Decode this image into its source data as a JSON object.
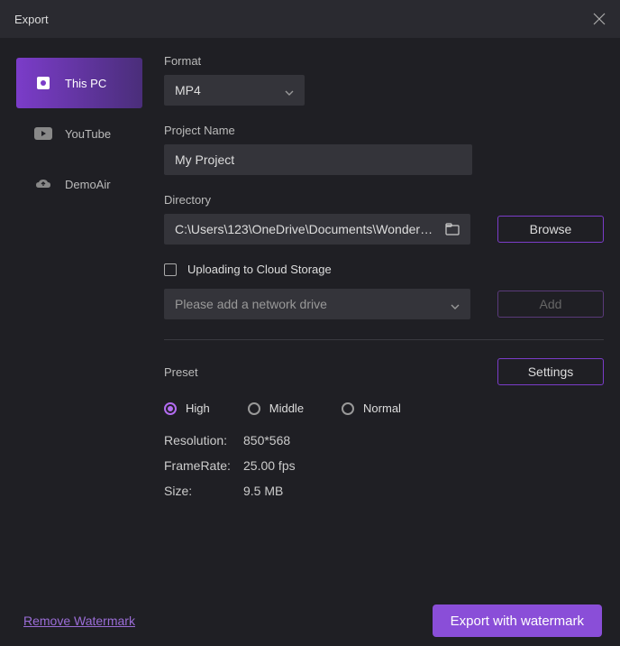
{
  "window": {
    "title": "Export"
  },
  "sidebar": {
    "items": [
      {
        "label": "This PC",
        "icon": "pc-icon",
        "active": true
      },
      {
        "label": "YouTube",
        "icon": "youtube-icon",
        "active": false
      },
      {
        "label": "DemoAir",
        "icon": "cloud-icon",
        "active": false
      }
    ]
  },
  "form": {
    "format_label": "Format",
    "format_value": "MP4",
    "project_name_label": "Project Name",
    "project_name_value": "My Project",
    "directory_label": "Directory",
    "directory_value": "C:\\Users\\123\\OneDrive\\Documents\\Wonders...",
    "browse_label": "Browse",
    "upload_checkbox_label": "Uploading to Cloud Storage",
    "network_drive_placeholder": "Please add a network drive",
    "add_label": "Add",
    "preset_label": "Preset",
    "settings_label": "Settings",
    "preset_options": [
      {
        "label": "High",
        "checked": true
      },
      {
        "label": "Middle",
        "checked": false
      },
      {
        "label": "Normal",
        "checked": false
      }
    ],
    "resolution_label": "Resolution:",
    "resolution_value": "850*568",
    "framerate_label": "FrameRate:",
    "framerate_value": "25.00 fps",
    "size_label": "Size:",
    "size_value": "9.5 MB"
  },
  "footer": {
    "remove_watermark": "Remove Watermark",
    "export_button": "Export with watermark"
  }
}
